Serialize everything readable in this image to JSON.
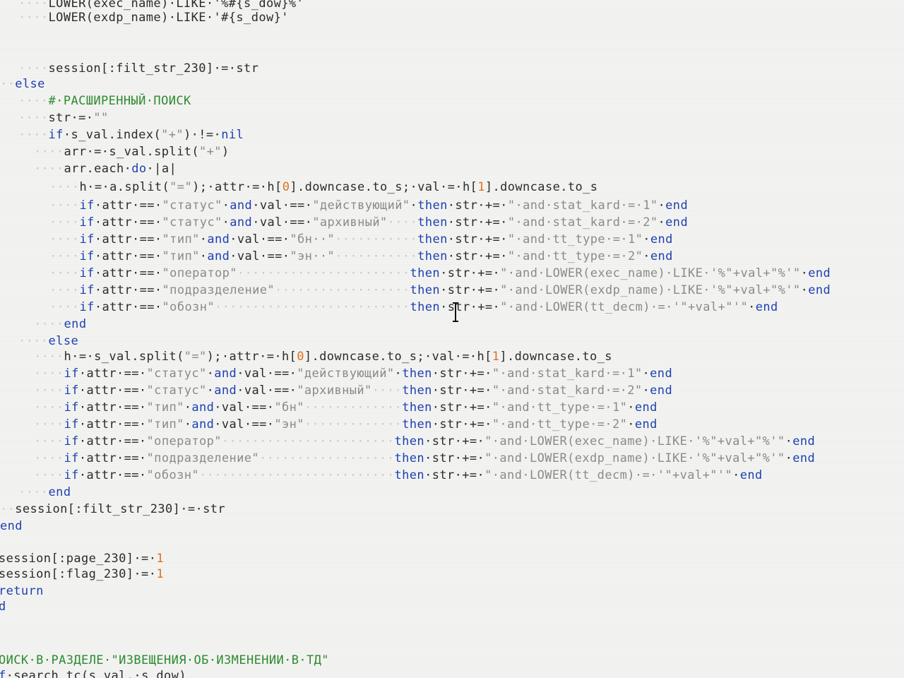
{
  "editor": {
    "language": "ruby",
    "colors": {
      "background": "#f3f4f2",
      "keyword": "#1e3fb0",
      "identifier": "#2b2b2b",
      "string": "#8a8a8a",
      "number": "#e07020",
      "comment": "#2f8a2f",
      "whitespace_marker": "#c9c9c9"
    },
    "lines": [
      {
        "indent": 2,
        "tokens": [
          [
            "LOWER(exec_name)·LIKE·'%#{s_dow}%'",
            "id"
          ]
        ]
      },
      {
        "indent": 2,
        "tokens": [
          [
            "LOWER(exdp_name)·LIKE·'#{s_dow}'",
            "id"
          ]
        ]
      },
      {
        "indent": 0,
        "tokens": []
      },
      {
        "indent": 0,
        "tokens": []
      },
      {
        "indent": 2,
        "tokens": [
          [
            "session[:filt_str_230]·=·str",
            "id"
          ]
        ]
      },
      {
        "indent": 1,
        "tokens": [
          [
            "else",
            "kw"
          ]
        ]
      },
      {
        "indent": 2,
        "tokens": [
          [
            "#·РАСШИРЕННЫЙ·ПОИСК",
            "cm"
          ]
        ]
      },
      {
        "indent": 2,
        "tokens": [
          [
            "str·=·",
            "id"
          ],
          [
            "\"\"",
            "str"
          ]
        ]
      },
      {
        "indent": 2,
        "tokens": [
          [
            "if",
            "kw"
          ],
          [
            "·s_val.index(",
            "id"
          ],
          [
            "\"+\"",
            "str"
          ],
          [
            ")·!=·",
            "id"
          ],
          [
            "nil",
            "kw"
          ]
        ]
      },
      {
        "indent": 3,
        "tokens": [
          [
            "arr·=·s_val.split(",
            "id"
          ],
          [
            "\"+\"",
            "str"
          ],
          [
            ")",
            "id"
          ]
        ]
      },
      {
        "indent": 3,
        "tokens": [
          [
            "arr.each·",
            "id"
          ],
          [
            "do",
            "kw"
          ],
          [
            "·|a|",
            "id"
          ]
        ]
      },
      {
        "indent": 4,
        "tokens": [
          [
            "h·=·a.split(",
            "id"
          ],
          [
            "\"=\"",
            "str"
          ],
          [
            ");·attr·=·h[",
            "id"
          ],
          [
            "0",
            "num"
          ],
          [
            "].downcase.to_s;·val·=·h[",
            "id"
          ],
          [
            "1",
            "num"
          ],
          [
            "].downcase.to_s",
            "id"
          ]
        ]
      },
      {
        "indent": 4,
        "tokens": [
          [
            "if",
            "kw"
          ],
          [
            "·attr·==·",
            "id"
          ],
          [
            "\"статус\"",
            "str"
          ],
          [
            "·",
            "id"
          ],
          [
            "and",
            "kw"
          ],
          [
            "·val·==·",
            "id"
          ],
          [
            "\"действующий\"",
            "str"
          ],
          [
            "·",
            "id"
          ],
          [
            "then",
            "kw"
          ],
          [
            "·str·+=·",
            "id"
          ],
          [
            "\"·and·stat_kard·=·1\"",
            "str"
          ],
          [
            "·",
            "id"
          ],
          [
            "end",
            "kw"
          ]
        ]
      },
      {
        "indent": 4,
        "tokens": [
          [
            "if",
            "kw"
          ],
          [
            "·attr·==·",
            "id"
          ],
          [
            "\"статус\"",
            "str"
          ],
          [
            "·",
            "id"
          ],
          [
            "and",
            "kw"
          ],
          [
            "·val·==·",
            "id"
          ],
          [
            "\"архивный\"",
            "str"
          ],
          [
            "····",
            "ws"
          ],
          [
            "then",
            "kw"
          ],
          [
            "·str·+=·",
            "id"
          ],
          [
            "\"·and·stat_kard·=·2\"",
            "str"
          ],
          [
            "·",
            "id"
          ],
          [
            "end",
            "kw"
          ]
        ]
      },
      {
        "indent": 4,
        "tokens": [
          [
            "if",
            "kw"
          ],
          [
            "·attr·==·",
            "id"
          ],
          [
            "\"тип\"",
            "str"
          ],
          [
            "·",
            "id"
          ],
          [
            "and",
            "kw"
          ],
          [
            "·val·==·",
            "id"
          ],
          [
            "\"бн··\"",
            "str"
          ],
          [
            "···········",
            "ws"
          ],
          [
            "then",
            "kw"
          ],
          [
            "·str·+=·",
            "id"
          ],
          [
            "\"·and·tt_type·=·1\"",
            "str"
          ],
          [
            "·",
            "id"
          ],
          [
            "end",
            "kw"
          ]
        ]
      },
      {
        "indent": 4,
        "tokens": [
          [
            "if",
            "kw"
          ],
          [
            "·attr·==·",
            "id"
          ],
          [
            "\"тип\"",
            "str"
          ],
          [
            "·",
            "id"
          ],
          [
            "and",
            "kw"
          ],
          [
            "·val·==·",
            "id"
          ],
          [
            "\"эн··\"",
            "str"
          ],
          [
            "···········",
            "ws"
          ],
          [
            "then",
            "kw"
          ],
          [
            "·str·+=·",
            "id"
          ],
          [
            "\"·and·tt_type·=·2\"",
            "str"
          ],
          [
            "·",
            "id"
          ],
          [
            "end",
            "kw"
          ]
        ]
      },
      {
        "indent": 4,
        "tokens": [
          [
            "if",
            "kw"
          ],
          [
            "·attr·==·",
            "id"
          ],
          [
            "\"оператор\"",
            "str"
          ],
          [
            "·······················",
            "ws"
          ],
          [
            "then",
            "kw"
          ],
          [
            "·str·+=·",
            "id"
          ],
          [
            "\"·and·LOWER(exec_name)·LIKE·'%\"+val+\"%'\"",
            "str"
          ],
          [
            "·",
            "id"
          ],
          [
            "end",
            "kw"
          ]
        ]
      },
      {
        "indent": 4,
        "tokens": [
          [
            "if",
            "kw"
          ],
          [
            "·attr·==·",
            "id"
          ],
          [
            "\"подразделение\"",
            "str"
          ],
          [
            "··················",
            "ws"
          ],
          [
            "then",
            "kw"
          ],
          [
            "·str·+=·",
            "id"
          ],
          [
            "\"·and·LOWER(exdp_name)·LIKE·'%\"+val+\"%'\"",
            "str"
          ],
          [
            "·",
            "id"
          ],
          [
            "end",
            "kw"
          ]
        ]
      },
      {
        "indent": 4,
        "tokens": [
          [
            "if",
            "kw"
          ],
          [
            "·attr·==·",
            "id"
          ],
          [
            "\"обозн\"",
            "str"
          ],
          [
            "··························",
            "ws"
          ],
          [
            "then",
            "kw"
          ],
          [
            "·str·+=·",
            "id"
          ],
          [
            "\"·and·LOWER(tt_decm)·=·'\"+val+\"'\"",
            "str"
          ],
          [
            "·",
            "id"
          ],
          [
            "end",
            "kw"
          ]
        ]
      },
      {
        "indent": 3,
        "tokens": [
          [
            "end",
            "kw"
          ]
        ]
      },
      {
        "indent": 2,
        "tokens": [
          [
            "else",
            "kw"
          ]
        ]
      },
      {
        "indent": 3,
        "tokens": [
          [
            "h·=·s_val.split(",
            "id"
          ],
          [
            "\"=\"",
            "str"
          ],
          [
            ");·attr·=·h[",
            "id"
          ],
          [
            "0",
            "num"
          ],
          [
            "].downcase.to_s;·val·=·h[",
            "id"
          ],
          [
            "1",
            "num"
          ],
          [
            "].downcase.to_s",
            "id"
          ]
        ]
      },
      {
        "indent": 3,
        "tokens": [
          [
            "if",
            "kw"
          ],
          [
            "·attr·==·",
            "id"
          ],
          [
            "\"статус\"",
            "str"
          ],
          [
            "·",
            "id"
          ],
          [
            "and",
            "kw"
          ],
          [
            "·val·==·",
            "id"
          ],
          [
            "\"действующий\"",
            "str"
          ],
          [
            "·",
            "id"
          ],
          [
            "then",
            "kw"
          ],
          [
            "·str·+=·",
            "id"
          ],
          [
            "\"·and·stat_kard·=·1\"",
            "str"
          ],
          [
            "·",
            "id"
          ],
          [
            "end",
            "kw"
          ]
        ]
      },
      {
        "indent": 3,
        "tokens": [
          [
            "if",
            "kw"
          ],
          [
            "·attr·==·",
            "id"
          ],
          [
            "\"статус\"",
            "str"
          ],
          [
            "·",
            "id"
          ],
          [
            "and",
            "kw"
          ],
          [
            "·val·==·",
            "id"
          ],
          [
            "\"архивный\"",
            "str"
          ],
          [
            "····",
            "ws"
          ],
          [
            "then",
            "kw"
          ],
          [
            "·str·+=·",
            "id"
          ],
          [
            "\"·and·stat_kard·=·2\"",
            "str"
          ],
          [
            "·",
            "id"
          ],
          [
            "end",
            "kw"
          ]
        ]
      },
      {
        "indent": 3,
        "tokens": [
          [
            "if",
            "kw"
          ],
          [
            "·attr·==·",
            "id"
          ],
          [
            "\"тип\"",
            "str"
          ],
          [
            "·",
            "id"
          ],
          [
            "and",
            "kw"
          ],
          [
            "·val·==·",
            "id"
          ],
          [
            "\"бн\"",
            "str"
          ],
          [
            "·············",
            "ws"
          ],
          [
            "then",
            "kw"
          ],
          [
            "·str·+=·",
            "id"
          ],
          [
            "\"·and·tt_type·=·1\"",
            "str"
          ],
          [
            "·",
            "id"
          ],
          [
            "end",
            "kw"
          ]
        ]
      },
      {
        "indent": 3,
        "tokens": [
          [
            "if",
            "kw"
          ],
          [
            "·attr·==·",
            "id"
          ],
          [
            "\"тип\"",
            "str"
          ],
          [
            "·",
            "id"
          ],
          [
            "and",
            "kw"
          ],
          [
            "·val·==·",
            "id"
          ],
          [
            "\"эн\"",
            "str"
          ],
          [
            "·············",
            "ws"
          ],
          [
            "then",
            "kw"
          ],
          [
            "·str·+=·",
            "id"
          ],
          [
            "\"·and·tt_type·=·2\"",
            "str"
          ],
          [
            "·",
            "id"
          ],
          [
            "end",
            "kw"
          ]
        ]
      },
      {
        "indent": 3,
        "tokens": [
          [
            "if",
            "kw"
          ],
          [
            "·attr·==·",
            "id"
          ],
          [
            "\"оператор\"",
            "str"
          ],
          [
            "·······················",
            "ws"
          ],
          [
            "then",
            "kw"
          ],
          [
            "·str·+=·",
            "id"
          ],
          [
            "\"·and·LOWER(exec_name)·LIKE·'%\"+val+\"%'\"",
            "str"
          ],
          [
            "·",
            "id"
          ],
          [
            "end",
            "kw"
          ]
        ]
      },
      {
        "indent": 3,
        "tokens": [
          [
            "if",
            "kw"
          ],
          [
            "·attr·==·",
            "id"
          ],
          [
            "\"подразделение\"",
            "str"
          ],
          [
            "··················",
            "ws"
          ],
          [
            "then",
            "kw"
          ],
          [
            "·str·+=·",
            "id"
          ],
          [
            "\"·and·LOWER(exdp_name)·LIKE·'%\"+val+\"%'\"",
            "str"
          ],
          [
            "·",
            "id"
          ],
          [
            "end",
            "kw"
          ]
        ]
      },
      {
        "indent": 3,
        "tokens": [
          [
            "if",
            "kw"
          ],
          [
            "·attr·==·",
            "id"
          ],
          [
            "\"обозн\"",
            "str"
          ],
          [
            "··························",
            "ws"
          ],
          [
            "then",
            "kw"
          ],
          [
            "·str·+=·",
            "id"
          ],
          [
            "\"·and·LOWER(tt_decm)·=·'\"+val+\"'\"",
            "str"
          ],
          [
            "·",
            "id"
          ],
          [
            "end",
            "kw"
          ]
        ]
      },
      {
        "indent": 2,
        "tokens": [
          [
            "end",
            "kw"
          ]
        ]
      },
      {
        "indent": 1,
        "tokens": [
          [
            "session[:filt_str_230]·=·str",
            "id"
          ]
        ]
      },
      {
        "indent": 0,
        "tokens": [
          [
            "end",
            "kw"
          ]
        ]
      },
      {
        "indent": 0,
        "tokens": []
      },
      {
        "indent": 0,
        "tokens": [
          [
            "session[:page_230]·=·",
            "id"
          ],
          [
            "1",
            "num"
          ]
        ]
      },
      {
        "indent": 0,
        "tokens": [
          [
            "session[:flag_230]·=·",
            "id"
          ],
          [
            "1",
            "num"
          ]
        ]
      },
      {
        "indent": 0,
        "tokens": [
          [
            "return",
            "kw"
          ]
        ]
      },
      {
        "indent": 0,
        "tokens": [
          [
            "d",
            "kw"
          ]
        ]
      },
      {
        "indent": 0,
        "tokens": []
      },
      {
        "indent": 0,
        "tokens": []
      },
      {
        "indent": 0,
        "tokens": [
          [
            "ОИСК·В·РАЗДЕЛЕ·\"ИЗВЕЩЕНИЯ·ОБ·ИЗМЕНЕНИИ·В·ТД\"",
            "cm"
          ]
        ]
      },
      {
        "indent": 0,
        "tokens": [
          [
            "f",
            "kw"
          ],
          [
            "·search_tc(s_val,·s_dow)",
            "id"
          ]
        ]
      }
    ]
  }
}
